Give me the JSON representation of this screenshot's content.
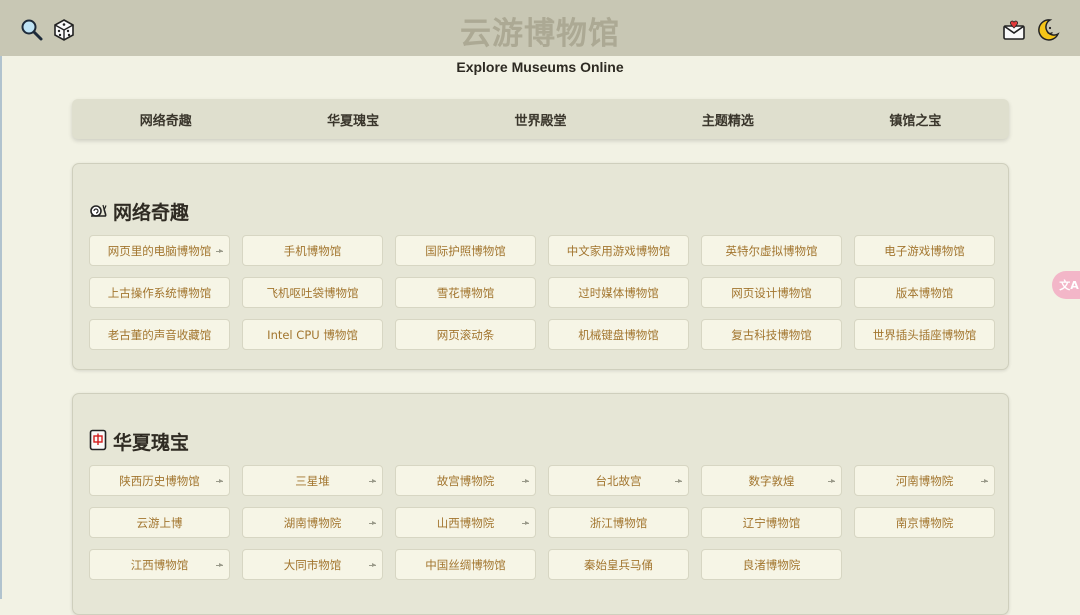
{
  "header": {
    "site_title": "云游博物馆",
    "subtitle": "Explore Museums Online",
    "left_icons": [
      "magnifier-icon",
      "dice-icon"
    ],
    "right_icons": [
      "mail-heart-icon",
      "moon-icon"
    ]
  },
  "nav": {
    "items": [
      {
        "label": "网络奇趣"
      },
      {
        "label": "华夏瑰宝"
      },
      {
        "label": "世界殿堂"
      },
      {
        "label": "主题精选"
      },
      {
        "label": "镇馆之宝"
      }
    ]
  },
  "sections": [
    {
      "title": "网络奇趣",
      "icon": "snail-icon",
      "tiles": [
        {
          "label": "网页里的电脑博物馆",
          "has_arrow": true
        },
        {
          "label": "手机博物馆",
          "has_arrow": false
        },
        {
          "label": "国际护照博物馆",
          "has_arrow": false
        },
        {
          "label": "中文家用游戏博物馆",
          "has_arrow": false
        },
        {
          "label": "英特尔虚拟博物馆",
          "has_arrow": false
        },
        {
          "label": "电子游戏博物馆",
          "has_arrow": false
        },
        {
          "label": "上古操作系统博物馆",
          "has_arrow": false
        },
        {
          "label": "飞机呕吐袋博物馆",
          "has_arrow": false
        },
        {
          "label": "雪花博物馆",
          "has_arrow": false
        },
        {
          "label": "过时媒体博物馆",
          "has_arrow": false
        },
        {
          "label": "网页设计博物馆",
          "has_arrow": false
        },
        {
          "label": "版本博物馆",
          "has_arrow": false
        },
        {
          "label": "老古董的声音收藏馆",
          "has_arrow": false
        },
        {
          "label": "Intel CPU 博物馆",
          "has_arrow": false
        },
        {
          "label": "网页滚动条",
          "has_arrow": false
        },
        {
          "label": "机械键盘博物馆",
          "has_arrow": false
        },
        {
          "label": "复古科技博物馆",
          "has_arrow": false
        },
        {
          "label": "世界插头插座博物馆",
          "has_arrow": false
        }
      ]
    },
    {
      "title": "华夏瑰宝",
      "icon": "mahjong-tile-icon",
      "tiles": [
        {
          "label": "陕西历史博物馆",
          "has_arrow": true
        },
        {
          "label": "三星堆",
          "has_arrow": true
        },
        {
          "label": "故宫博物院",
          "has_arrow": true
        },
        {
          "label": "台北故宫",
          "has_arrow": true
        },
        {
          "label": "数字敦煌",
          "has_arrow": true
        },
        {
          "label": "河南博物院",
          "has_arrow": true
        },
        {
          "label": "云游上博",
          "has_arrow": false
        },
        {
          "label": "湖南博物院",
          "has_arrow": true
        },
        {
          "label": "山西博物院",
          "has_arrow": true
        },
        {
          "label": "浙江博物馆",
          "has_arrow": false
        },
        {
          "label": "辽宁博物馆",
          "has_arrow": false
        },
        {
          "label": "南京博物院",
          "has_arrow": false
        },
        {
          "label": "江西博物馆",
          "has_arrow": true
        },
        {
          "label": "大同市物馆",
          "has_arrow": true
        },
        {
          "label": "中国丝绸博物馆",
          "has_arrow": false
        },
        {
          "label": "秦始皇兵马俑",
          "has_arrow": false
        },
        {
          "label": "良渚博物院",
          "has_arrow": false
        }
      ]
    }
  ],
  "translate_button": {
    "label": "文A"
  },
  "colors": {
    "topbar": "#c8c7b4",
    "page_bg": "#f2f2e4",
    "tile_text": "#a2752e",
    "title_faded": "#aca994"
  }
}
